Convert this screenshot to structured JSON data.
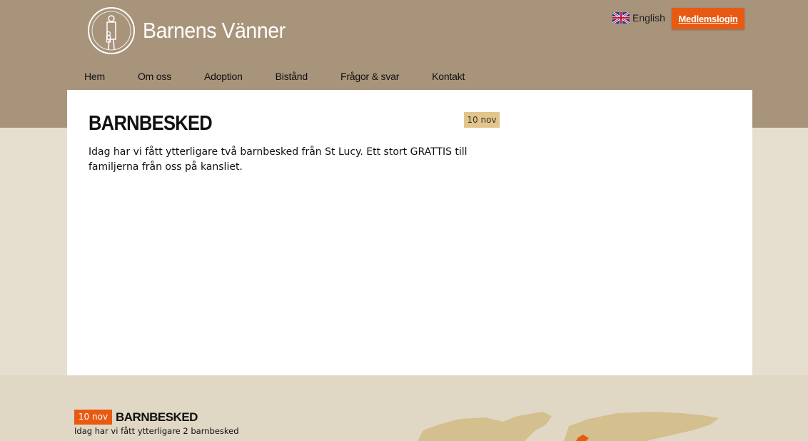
{
  "header": {
    "brand": "Barnens Vänner",
    "language_label": "English",
    "login_label": "Medlemslogin"
  },
  "nav": {
    "items": [
      {
        "label": "Hem"
      },
      {
        "label": "Om oss"
      },
      {
        "label": "Adoption"
      },
      {
        "label": "Bistånd"
      },
      {
        "label": "Frågor & svar"
      },
      {
        "label": "Kontakt"
      }
    ]
  },
  "post": {
    "title": "BARNBESKED",
    "date": "10 nov",
    "body": "Idag har vi fått ytterligare två barnbesked från St Lucy. Ett stort GRATTIS till familjerna från oss på kansliet."
  },
  "footer": {
    "news_date": "10 nov",
    "news_title": "BARNBESKED",
    "news_text": "Idag har vi fått ytterligare 2 barnbesked"
  },
  "colors": {
    "header_bg": "#a8947b",
    "page_bg": "#e6dfd0",
    "accent": "#e85a12",
    "date_badge": "#e2c58a"
  }
}
